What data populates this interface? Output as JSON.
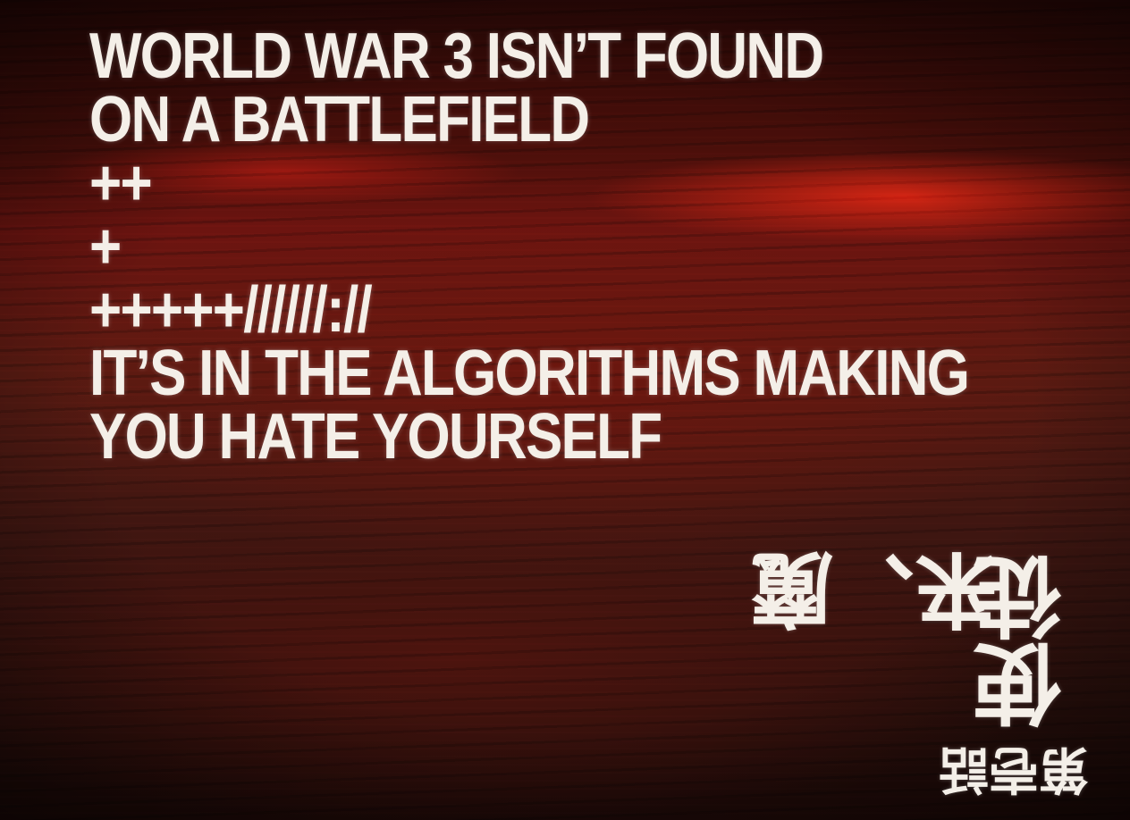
{
  "screen": {
    "lines": [
      "WORLD WAR 3 ISN’T FOUND",
      "ON A BATTLEFIELD",
      "++",
      "+",
      "+++++//////://",
      "IT’S IN THE ALGORITHMS MAKING",
      "YOU HATE YOURSELF"
    ],
    "kanji": {
      "a": "来、魔",
      "b": "使徒",
      "c": "第壱話"
    }
  }
}
